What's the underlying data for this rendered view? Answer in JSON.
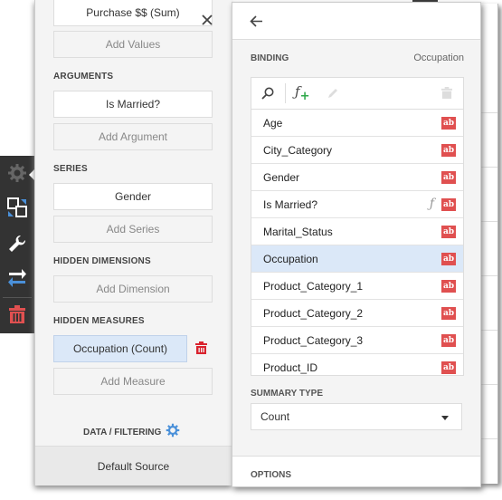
{
  "left_panel": {
    "values_item": "Purchase $$ (Sum)",
    "add_values": "Add Values",
    "arguments_header": "ARGUMENTS",
    "argument_item": "Is Married?",
    "add_argument": "Add Argument",
    "series_header": "SERIES",
    "series_item": "Gender",
    "add_series": "Add Series",
    "hidden_dimensions_header": "HIDDEN DIMENSIONS",
    "add_dimension": "Add Dimension",
    "hidden_measures_header": "HIDDEN MEASURES",
    "measure_item": "Occupation (Count)",
    "add_measure": "Add Measure",
    "data_filtering_label": "DATA / FILTERING",
    "data_source": "Default Source"
  },
  "toolbar": {
    "icons": [
      "gear-icon",
      "convert-icon",
      "wrench-icon",
      "swap-icon",
      "trash-icon"
    ]
  },
  "right_panel": {
    "binding_header": "BINDING",
    "binding_value": "Occupation",
    "fields": [
      {
        "name": "Age",
        "type": "ab",
        "calculated": false,
        "selected": false
      },
      {
        "name": "City_Category",
        "type": "ab",
        "calculated": false,
        "selected": false
      },
      {
        "name": "Gender",
        "type": "ab",
        "calculated": false,
        "selected": false
      },
      {
        "name": "Is Married?",
        "type": "ab",
        "calculated": true,
        "selected": false
      },
      {
        "name": "Marital_Status",
        "type": "ab",
        "calculated": false,
        "selected": false
      },
      {
        "name": "Occupation",
        "type": "ab",
        "calculated": false,
        "selected": true
      },
      {
        "name": "Product_Category_1",
        "type": "ab",
        "calculated": false,
        "selected": false
      },
      {
        "name": "Product_Category_2",
        "type": "ab",
        "calculated": false,
        "selected": false
      },
      {
        "name": "Product_Category_3",
        "type": "ab",
        "calculated": false,
        "selected": false
      },
      {
        "name": "Product_ID",
        "type": "ab",
        "calculated": false,
        "selected": false
      }
    ],
    "summary_type_header": "SUMMARY TYPE",
    "summary_type_value": "Count",
    "options_header": "OPTIONS"
  },
  "colors": {
    "accent_blue": "#4a90d9",
    "type_badge": "#e05050",
    "delete_red": "#d9232e",
    "selected_bg": "#dbe8f8",
    "add_green": "#2ea84a"
  }
}
